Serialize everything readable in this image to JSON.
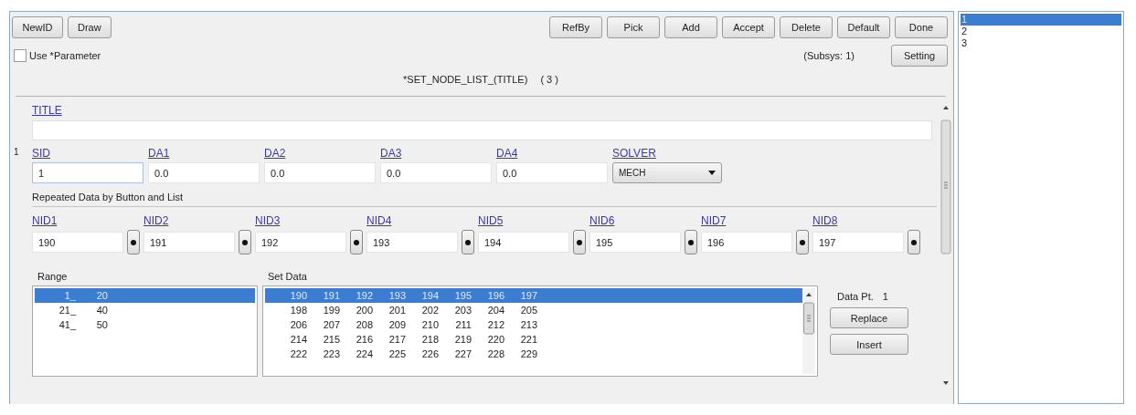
{
  "toolbar": {
    "left_buttons": [
      "NewID",
      "Draw"
    ],
    "right_buttons": [
      "RefBy",
      "Pick",
      "Add",
      "Accept",
      "Delete",
      "Default",
      "Done"
    ]
  },
  "use_parameter": {
    "label": "Use *Parameter",
    "checked": false
  },
  "subsys": "(Subsys: 1)",
  "setting_button": "Setting",
  "card_title": "*SET_NODE_LIST_(TITLE)",
  "card_count": "( 3 )",
  "title_field": {
    "label": "TITLE"
  },
  "row_number": "1",
  "card_fields": [
    {
      "label": "SID",
      "value": "1",
      "kind": "text",
      "focused": true
    },
    {
      "label": "DA1",
      "value": "0.0",
      "kind": "text",
      "focused": false
    },
    {
      "label": "DA2",
      "value": "0.0",
      "kind": "text",
      "focused": false
    },
    {
      "label": "DA3",
      "value": "0.0",
      "kind": "text",
      "focused": false
    },
    {
      "label": "DA4",
      "value": "0.0",
      "kind": "text",
      "focused": false
    },
    {
      "label": "SOLVER",
      "value": "MECH",
      "kind": "select",
      "focused": false
    }
  ],
  "repeated_heading": "Repeated Data by Button and List",
  "nid_fields": [
    {
      "label": "NID1",
      "value": "190"
    },
    {
      "label": "NID2",
      "value": "191"
    },
    {
      "label": "NID3",
      "value": "192"
    },
    {
      "label": "NID4",
      "value": "193"
    },
    {
      "label": "NID5",
      "value": "194"
    },
    {
      "label": "NID6",
      "value": "195"
    },
    {
      "label": "NID7",
      "value": "196"
    },
    {
      "label": "NID8",
      "value": "197"
    }
  ],
  "range": {
    "label": "Range",
    "items": [
      {
        "start": "1_",
        "end": "20",
        "selected": true
      },
      {
        "start": "21_",
        "end": "40",
        "selected": false
      },
      {
        "start": "41_",
        "end": "50",
        "selected": false
      }
    ]
  },
  "set_data": {
    "label": "Set Data",
    "rows": [
      {
        "values": [
          "190",
          "191",
          "192",
          "193",
          "194",
          "195",
          "196",
          "197"
        ],
        "selected": true
      },
      {
        "values": [
          "198",
          "199",
          "200",
          "201",
          "202",
          "203",
          "204",
          "205"
        ],
        "selected": false
      },
      {
        "values": [
          "206",
          "207",
          "208",
          "209",
          "210",
          "211",
          "212",
          "213"
        ],
        "selected": false
      },
      {
        "values": [
          "214",
          "215",
          "216",
          "217",
          "218",
          "219",
          "220",
          "221"
        ],
        "selected": false
      },
      {
        "values": [
          "222",
          "223",
          "224",
          "225",
          "226",
          "227",
          "228",
          "229"
        ],
        "selected": false
      }
    ]
  },
  "data_point": {
    "label": "Data Pt.",
    "value": "1"
  },
  "side_buttons": [
    "Replace",
    "Insert"
  ],
  "card_list": [
    {
      "label": "1",
      "selected": true
    },
    {
      "label": "2",
      "selected": false
    },
    {
      "label": "3",
      "selected": false
    }
  ]
}
